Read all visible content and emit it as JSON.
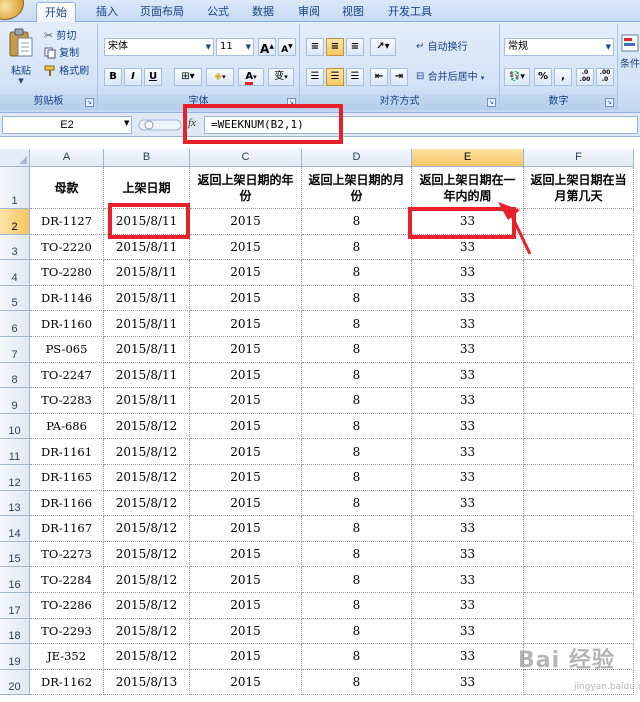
{
  "ribbon": {
    "tabs": [
      "开始",
      "插入",
      "页面布局",
      "公式",
      "数据",
      "审阅",
      "视图",
      "开发工具"
    ],
    "active_tab": "开始",
    "clipboard": {
      "paste": "粘贴",
      "cut": "剪切",
      "copy": "复制",
      "format_painter": "格式刷",
      "label": "剪贴板"
    },
    "font": {
      "name": "宋体",
      "size": "11",
      "grow": "A",
      "shrink": "A",
      "bold": "B",
      "italic": "I",
      "underline": "U",
      "font_color": "A",
      "phonetic": "变",
      "label": "字体"
    },
    "alignment": {
      "wrap_text": "自动换行",
      "merge_center": "合并后居中",
      "label": "对齐方式"
    },
    "number": {
      "format": "常规",
      "percent": "%",
      "comma": ",",
      "increase_decimal": ".0 .00",
      "decrease_decimal": ".00 .0",
      "label": "数字"
    },
    "styles": {
      "conditional": "条件"
    }
  },
  "formula_bar": {
    "name_box": "E2",
    "fx": "fx",
    "formula": "=WEEKNUM(B2,1)"
  },
  "sheet": {
    "columns": [
      "A",
      "B",
      "C",
      "D",
      "E",
      "F"
    ],
    "selected_column": "E",
    "selected_row": "2",
    "row_numbers": [
      "1",
      "2",
      "3",
      "4",
      "5",
      "6",
      "7",
      "8",
      "9",
      "10",
      "11",
      "12",
      "13",
      "14",
      "15",
      "16",
      "17",
      "18",
      "19",
      "20"
    ],
    "headers": [
      "母款",
      "上架日期",
      "返回上架日期的年份",
      "返回上架日期的月份",
      "返回上架日期在一年内的周",
      "返回上架日期在当月第几天"
    ],
    "rows": [
      [
        "DR-1127",
        "2015/8/11",
        "2015",
        "8",
        "33",
        ""
      ],
      [
        "TO-2220",
        "2015/8/11",
        "2015",
        "8",
        "33",
        ""
      ],
      [
        "TO-2280",
        "2015/8/11",
        "2015",
        "8",
        "33",
        ""
      ],
      [
        "DR-1146",
        "2015/8/11",
        "2015",
        "8",
        "33",
        ""
      ],
      [
        "DR-1160",
        "2015/8/11",
        "2015",
        "8",
        "33",
        ""
      ],
      [
        "PS-065",
        "2015/8/11",
        "2015",
        "8",
        "33",
        ""
      ],
      [
        "TO-2247",
        "2015/8/11",
        "2015",
        "8",
        "33",
        ""
      ],
      [
        "TO-2283",
        "2015/8/11",
        "2015",
        "8",
        "33",
        ""
      ],
      [
        "PA-686",
        "2015/8/12",
        "2015",
        "8",
        "33",
        ""
      ],
      [
        "DR-1161",
        "2015/8/12",
        "2015",
        "8",
        "33",
        ""
      ],
      [
        "DR-1165",
        "2015/8/12",
        "2015",
        "8",
        "33",
        ""
      ],
      [
        "DR-1166",
        "2015/8/12",
        "2015",
        "8",
        "33",
        ""
      ],
      [
        "DR-1167",
        "2015/8/12",
        "2015",
        "8",
        "33",
        ""
      ],
      [
        "TO-2273",
        "2015/8/12",
        "2015",
        "8",
        "33",
        ""
      ],
      [
        "TO-2284",
        "2015/8/12",
        "2015",
        "8",
        "33",
        ""
      ],
      [
        "TO-2286",
        "2015/8/12",
        "2015",
        "8",
        "33",
        ""
      ],
      [
        "TO-2293",
        "2015/8/12",
        "2015",
        "8",
        "33",
        ""
      ],
      [
        "JE-352",
        "2015/8/12",
        "2015",
        "8",
        "33",
        ""
      ],
      [
        "DR-1162",
        "2015/8/13",
        "2015",
        "8",
        "33",
        ""
      ]
    ]
  },
  "watermark": {
    "main": "Bai 经验",
    "sub": "jingyan.baidu.com"
  },
  "colors": {
    "annotation_red": "#e8202a",
    "ribbon_blue": "#15428b",
    "selected_header": "#f6c564"
  }
}
